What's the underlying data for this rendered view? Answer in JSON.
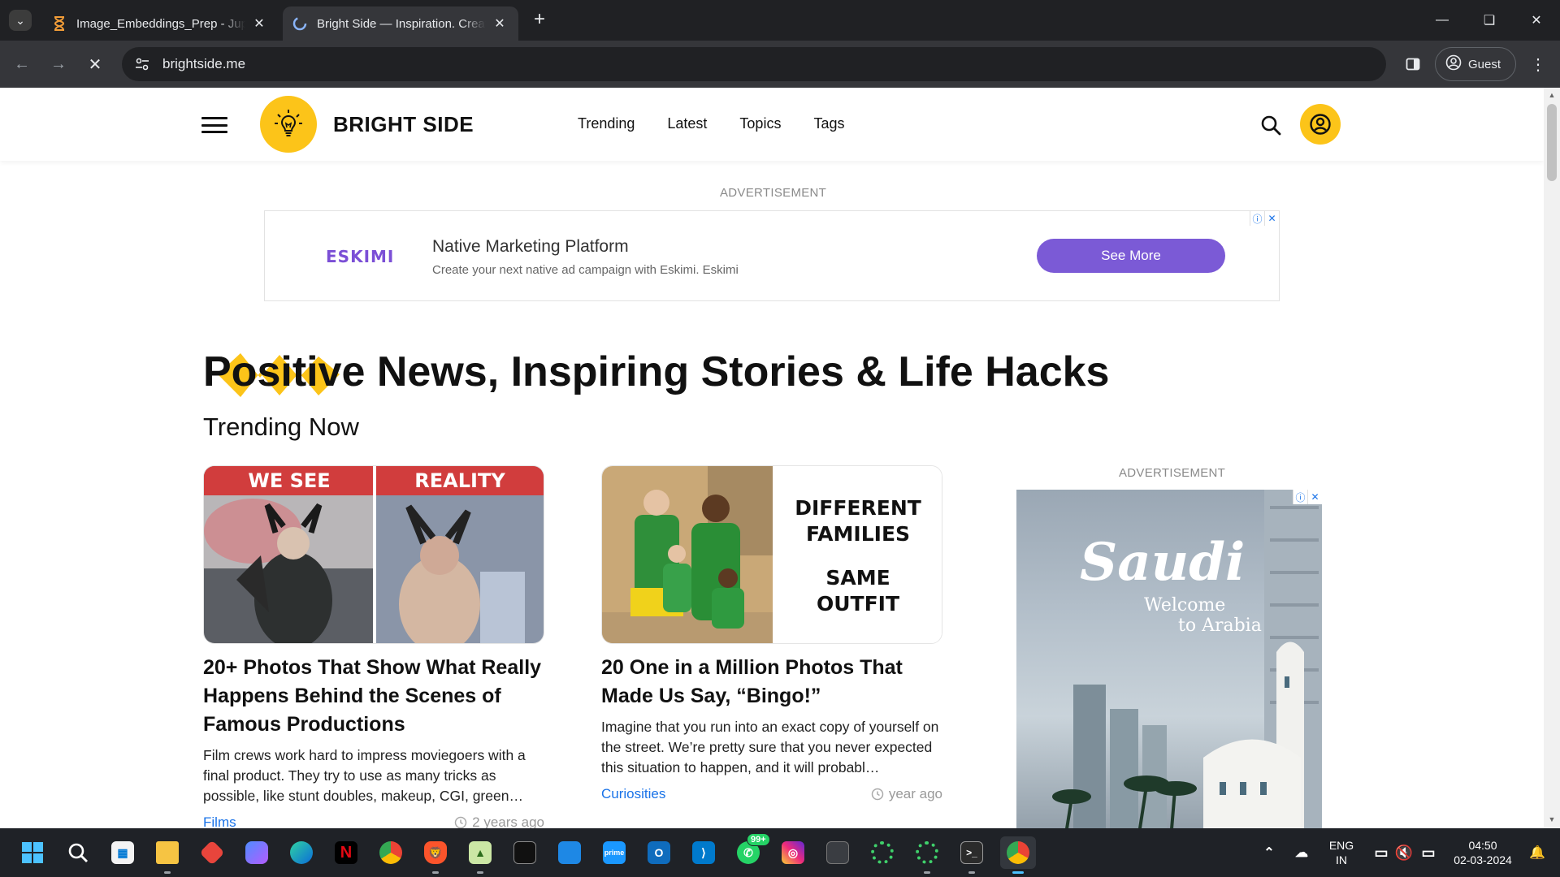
{
  "browser": {
    "tabs": [
      {
        "title": "Image_Embeddings_Prep - Jupy",
        "active": false,
        "favicon": "hourglass-icon"
      },
      {
        "title": "Bright Side — Inspiration. Creat",
        "active": true,
        "favicon": "loading-icon"
      }
    ],
    "address": "brightside.me",
    "profile_label": "Guest"
  },
  "site": {
    "logo_text": "BRIGHT SIDE",
    "nav": [
      "Trending",
      "Latest",
      "Topics",
      "Tags"
    ],
    "brand_color": "#fcc419"
  },
  "ad_top": {
    "label": "ADVERTISEMENT",
    "logo": "ESKIMI",
    "title": "Native Marketing Platform",
    "description": "Create your next native ad campaign with Eskimi. Eskimi",
    "cta": "See More"
  },
  "hero": {
    "title_highlight": "Positive",
    "title_rest": " News, Inspiring Stories & Life Hacks",
    "subtitle": "Trending Now"
  },
  "articles": [
    {
      "image_left_caption": "WE SEE",
      "image_right_caption": "REALITY",
      "title": "20+ Photos That Show What Really Happens Behind the Scenes of Famous Productions",
      "description": "Film crews work hard to impress moviegoers with a final product. They try to use as many tricks as possible, like stunt doubles, makeup, CGI, green…",
      "category": "Films",
      "time": "2 years ago"
    },
    {
      "image_line1": "DIFFERENT",
      "image_line2": "FAMILIES",
      "image_line3": "SAME",
      "image_line4": "OUTFIT",
      "title": "20 One in a Million Photos That Made Us Say, “Bingo!”",
      "description": "Imagine that you run into an exact copy of yourself on the street. We’re pretty sure that you never expected this situation to happen, and it will probabl…",
      "category": "Curiosities",
      "time": "year ago"
    }
  ],
  "ad_side": {
    "label": "ADVERTISEMENT",
    "brand": "Saudi",
    "tagline1": "Welcome",
    "tagline2": "to Arabia"
  },
  "taskbar": {
    "badge_count": "99+",
    "lang_line1": "ENG",
    "lang_line2": "IN",
    "time": "04:50",
    "date": "02-03-2024"
  }
}
